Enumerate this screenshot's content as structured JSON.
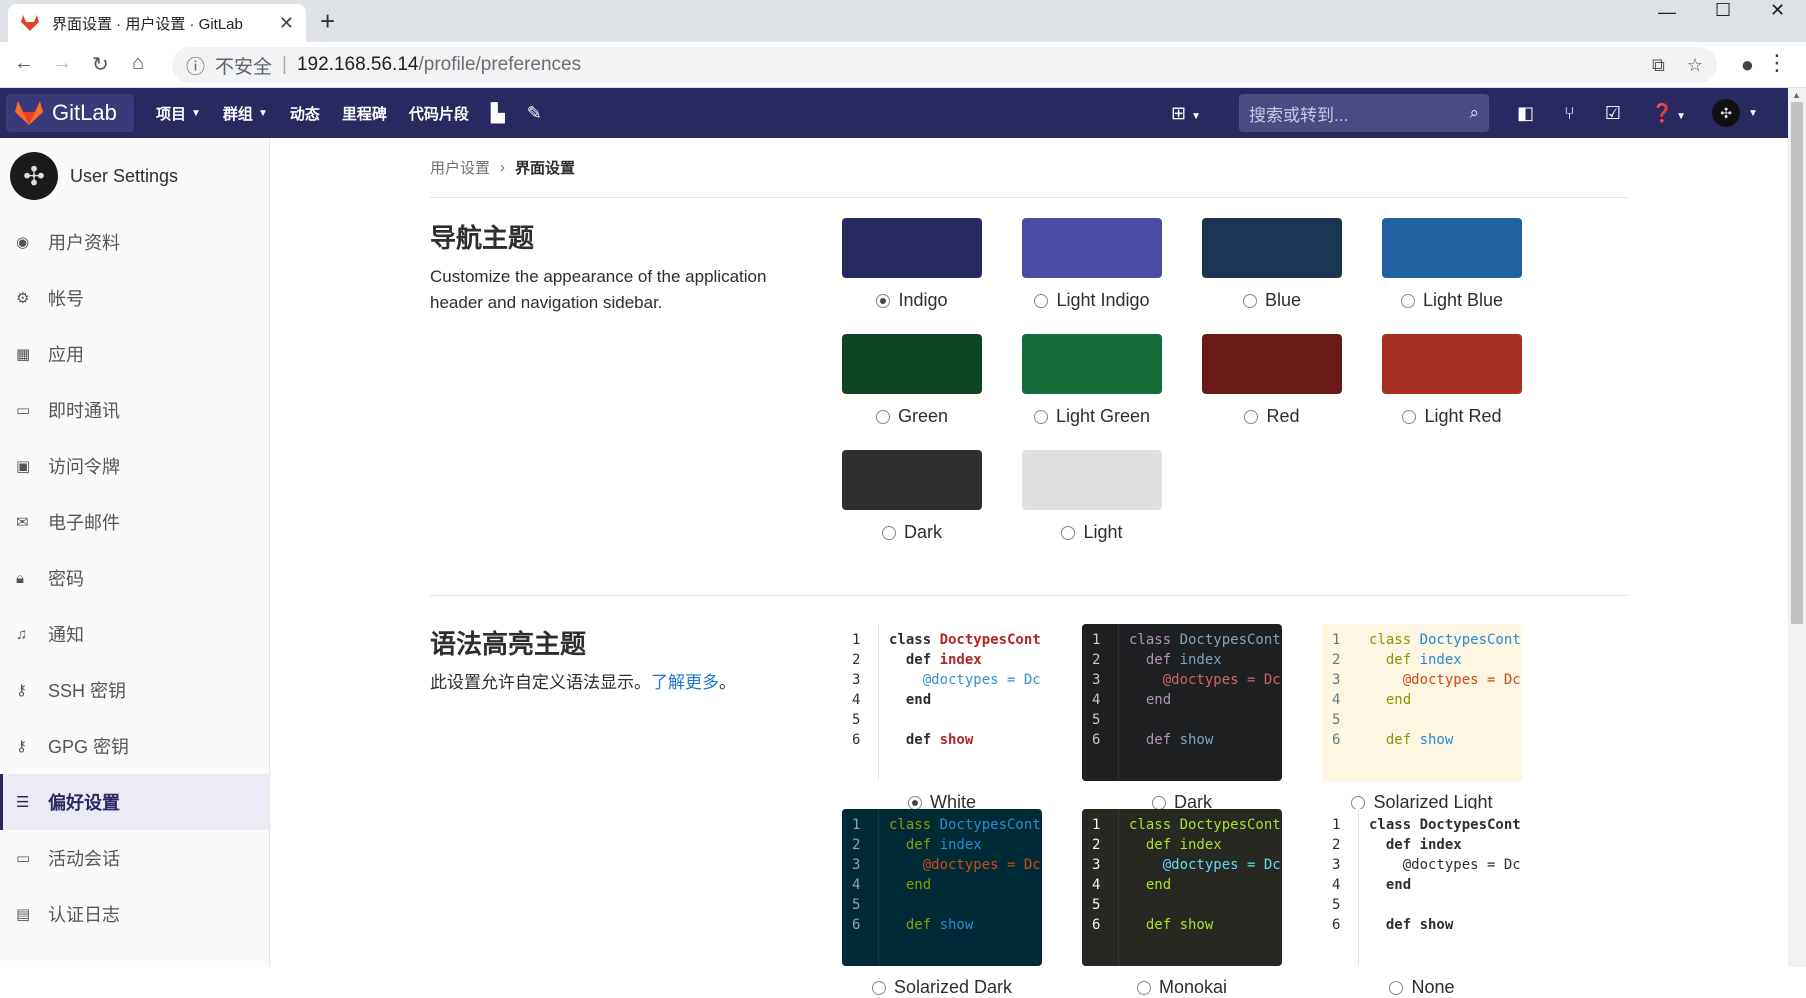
{
  "browser": {
    "tab_title": "界面设置 · 用户设置 · GitLab",
    "new_tab": "+",
    "url_warning": "不安全",
    "url_host": "192.168.56.14",
    "url_path": "/profile/preferences"
  },
  "topnav": {
    "brand": "GitLab",
    "items": [
      "项目",
      "群组",
      "动态",
      "里程碑",
      "代码片段"
    ],
    "search_placeholder": "搜索或转到..."
  },
  "sidebar": {
    "title": "User Settings",
    "items": [
      "用户资料",
      "帐号",
      "应用",
      "即时通讯",
      "访问令牌",
      "电子邮件",
      "密码",
      "通知",
      "SSH 密钥",
      "GPG 密钥",
      "偏好设置",
      "活动会话",
      "认证日志"
    ],
    "active": "偏好设置"
  },
  "breadcrumb": {
    "parent": "用户设置",
    "current": "界面设置"
  },
  "nav_theme": {
    "title": "导航主题",
    "desc": "Customize the appearance of the application header and navigation sidebar.",
    "options": [
      {
        "name": "Indigo",
        "color": "#292961",
        "selected": true
      },
      {
        "name": "Light Indigo",
        "color": "#4b4ba3",
        "selected": false
      },
      {
        "name": "Blue",
        "color": "#1a3652",
        "selected": false
      },
      {
        "name": "Light Blue",
        "color": "#2261a1",
        "selected": false
      },
      {
        "name": "Green",
        "color": "#0d4524",
        "selected": false
      },
      {
        "name": "Light Green",
        "color": "#156b39",
        "selected": false
      },
      {
        "name": "Red",
        "color": "#691a16",
        "selected": false
      },
      {
        "name": "Light Red",
        "color": "#a62e21",
        "selected": false
      },
      {
        "name": "Dark",
        "color": "#2e2e2e",
        "selected": false
      },
      {
        "name": "Light",
        "color": "#dfdfdf",
        "selected": false
      }
    ]
  },
  "syntax_theme": {
    "title": "语法高亮主题",
    "desc": "此设置允许自定义语法显示。",
    "learn_more": "了解更多",
    "desc_end": "。",
    "line_numbers": [
      "1",
      "2",
      "3",
      "4",
      "5",
      "6"
    ],
    "code": [
      "class DoctypesCont",
      "  def index",
      "    @doctypes = Dc",
      "  end",
      "",
      "  def show"
    ],
    "options": [
      {
        "name": "White",
        "bg": "#ffffff",
        "gutter": "#ffffff",
        "fg": "#2e2e2e",
        "kw": "#2e2e2e",
        "name_color": "#b72323",
        "var": "#3a8fc9",
        "selected": true
      },
      {
        "name": "Dark",
        "bg": "#1d1f21",
        "gutter": "#1d1f21",
        "fg": "#c5c8c6",
        "kw": "#b294bb",
        "name_color": "#81a2be",
        "var": "#cc6666",
        "selected": false
      },
      {
        "name": "Solarized Light",
        "bg": "#fdf6e3",
        "gutter": "#fdf6e3",
        "fg": "#657b83",
        "kw": "#859900",
        "name_color": "#268bd2",
        "var": "#cb4b16",
        "selected": false
      },
      {
        "name": "Solarized Dark",
        "bg": "#002b36",
        "gutter": "#002b36",
        "fg": "#93a1a1",
        "kw": "#859900",
        "name_color": "#268bd2",
        "var": "#cb4b16",
        "selected": false
      },
      {
        "name": "Monokai",
        "bg": "#272822",
        "gutter": "#272822",
        "fg": "#f8f8f2",
        "kw": "#a6e22e",
        "name_color": "#a6e22e",
        "var": "#66d9ef",
        "selected": false
      },
      {
        "name": "None",
        "bg": "#ffffff",
        "gutter": "#ffffff",
        "fg": "#2e2e2e",
        "kw": "#2e2e2e",
        "name_color": "#2e2e2e",
        "var": "#2e2e2e",
        "selected": false
      }
    ]
  }
}
